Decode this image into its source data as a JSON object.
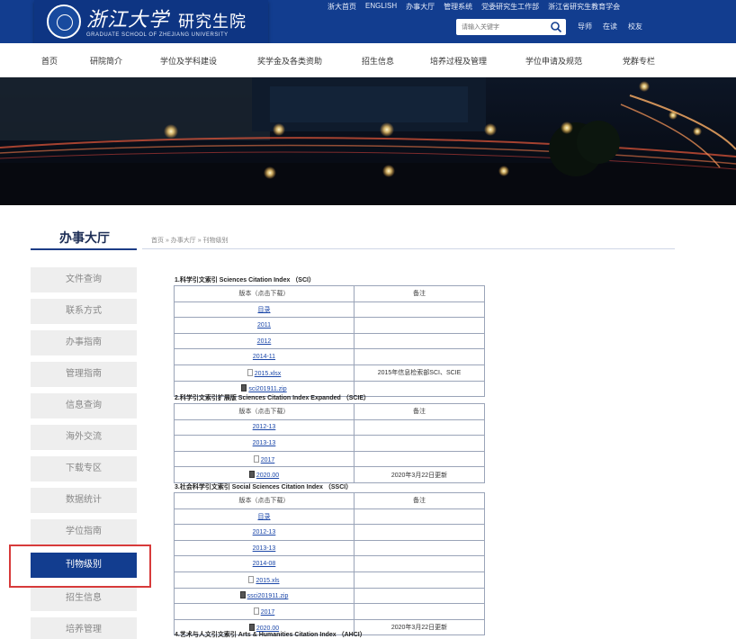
{
  "header": {
    "univ_name": "浙江大学",
    "school_name": "研究生院",
    "school_en": "GRADUATE SCHOOL OF ZHEJIANG UNIVERSITY",
    "top_links": [
      "浙大首页",
      "ENGLISH",
      "办事大厅",
      "管理系统",
      "党委研究生工作部",
      "浙江省研究生教育学会"
    ],
    "search_placeholder": "请输入关键字",
    "quick_links": [
      "导师",
      "在读",
      "校友"
    ]
  },
  "nav": {
    "items": [
      "首页",
      "研院简介",
      "学位及学科建设",
      "奖学金及各类资助",
      "招生信息",
      "培养过程及管理",
      "学位申请及规范",
      "党群专栏"
    ]
  },
  "sidebar": {
    "title": "办事大厅",
    "items": [
      "文件查询",
      "联系方式",
      "办事指南",
      "管理指南",
      "信息查询",
      "海外交流",
      "下载专区",
      "数据统计",
      "学位指南",
      "刊物级别",
      "招生信息",
      "培养管理"
    ],
    "active_index": 9
  },
  "breadcrumb": "首页 » 办事大厅 » 刊物级别",
  "sections": [
    {
      "title": "1.科学引文索引 Sciences Citation Index （SCI）",
      "header": [
        "版本（点击下载）",
        "备注"
      ],
      "rows": [
        {
          "name": "目录",
          "icon": "",
          "note": ""
        },
        {
          "name": "2011",
          "icon": "",
          "note": ""
        },
        {
          "name": "2012",
          "icon": "",
          "note": ""
        },
        {
          "name": "2014-11",
          "icon": "",
          "note": ""
        },
        {
          "name": "2015.xlsx",
          "icon": "doc",
          "note": "2015年信息检索部SCI、SCIE"
        },
        {
          "name": "sci201911.zip",
          "icon": "zip",
          "note": ""
        }
      ]
    },
    {
      "title": "2.科学引文索引扩展版 Sciences Citation Index Expanded （SCIE）",
      "header": [
        "版本（点击下载）",
        "备注"
      ],
      "rows": [
        {
          "name": "2012-13",
          "icon": "",
          "note": ""
        },
        {
          "name": "2013-13",
          "icon": "",
          "note": ""
        },
        {
          "name": "2017",
          "icon": "doc",
          "note": ""
        },
        {
          "name": "2020.00",
          "icon": "zip",
          "note": "2020年3月22日更新"
        }
      ]
    },
    {
      "title": "3.社会科学引文索引 Social Sciences Citation Index （SSCI）",
      "header": [
        "版本（点击下载）",
        "备注"
      ],
      "rows": [
        {
          "name": "目录",
          "icon": "",
          "note": ""
        },
        {
          "name": "2012-13",
          "icon": "",
          "note": ""
        },
        {
          "name": "2013-13",
          "icon": "",
          "note": ""
        },
        {
          "name": "2014-08",
          "icon": "",
          "note": ""
        },
        {
          "name": "2015.xls",
          "icon": "doc",
          "note": ""
        },
        {
          "name": "ssci201911.zip",
          "icon": "zip",
          "note": ""
        },
        {
          "name": "2017",
          "icon": "doc",
          "note": ""
        },
        {
          "name": "2020.00",
          "icon": "zip",
          "note": "2020年3月22日更新"
        }
      ]
    },
    {
      "title": "4.艺术与人文引文索引 Arts & Humanities Citation Index （AHCI）",
      "header": [],
      "rows": []
    }
  ],
  "colors": {
    "header_bg": "#123d8f",
    "active_item": "#123d8f",
    "highlight_border": "#d73a3a",
    "link": "#1a46a8"
  }
}
